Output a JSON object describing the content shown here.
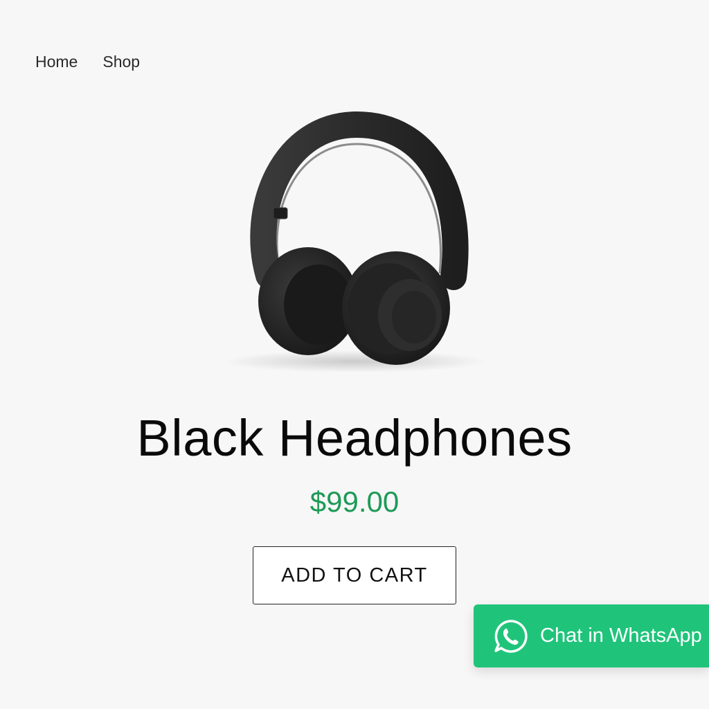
{
  "nav": {
    "items": [
      {
        "label": "Home"
      },
      {
        "label": "Shop"
      }
    ]
  },
  "product": {
    "image_icon": "headphones-image",
    "title": "Black Headphones",
    "price": "$99.00",
    "add_to_cart_label": "ADD TO CART"
  },
  "whatsapp": {
    "label": "Chat in WhatsApp",
    "icon": "whatsapp-icon",
    "color": "#1fc47a"
  },
  "colors": {
    "background": "#f7f7f7",
    "price": "#1e9a57",
    "accent": "#1fc47a"
  }
}
